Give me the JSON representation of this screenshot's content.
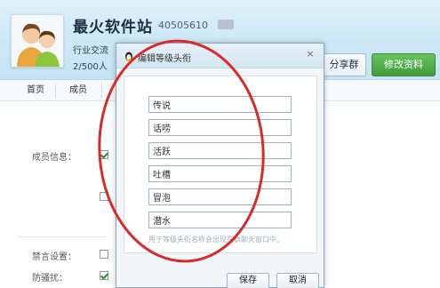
{
  "header": {
    "group_name": "最火软件站",
    "group_id": "40505610",
    "category": "行业交流",
    "members_count": "2/500人",
    "share_label": "分享群",
    "edit_label": "修改资料"
  },
  "tabs": [
    {
      "label": "首页"
    },
    {
      "label": "成员"
    }
  ],
  "settings": {
    "member_info_label": "成员信息：",
    "mute_label": "禁言设置：",
    "anti_harass_label": "防骚扰："
  },
  "dialog": {
    "title": "编辑等级头衔",
    "close_glyph": "×",
    "ranks": [
      "传说",
      "话唠",
      "活跃",
      "吐槽",
      "冒泡",
      "潜水"
    ],
    "hint": "用于等级头衔名称会出现在群聊天窗口中。",
    "save_label": "保存",
    "cancel_label": "取消"
  },
  "colors": {
    "accent_green": "#3f9d39",
    "header_bg": "#cfe9f7",
    "annotation_red": "#d92b2b"
  }
}
